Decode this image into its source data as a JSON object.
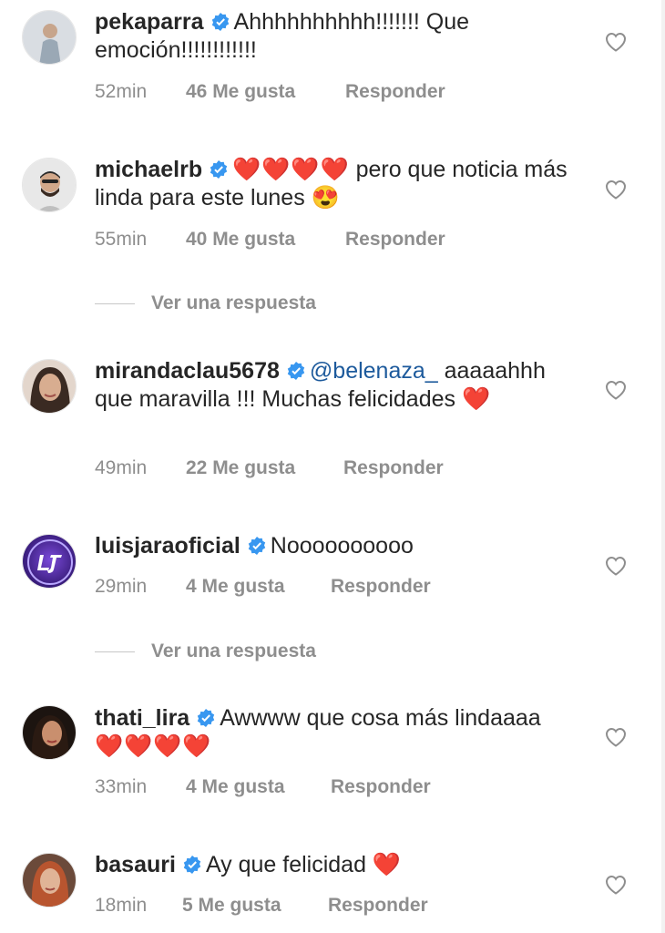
{
  "comments": [
    {
      "username": "pekaparra",
      "text": "Ahhhhhhhhhh!!!!!!! Que emoción!!!!!!!!!!!!",
      "time": "52min",
      "likes": "46 Me gusta",
      "reply": "Responder"
    },
    {
      "username": "michaelrb",
      "hearts": "❤️❤️❤️❤️",
      "text": " pero que noticia más linda para este lunes 😍",
      "time": "55min",
      "likes": "40 Me gusta",
      "reply": "Responder"
    },
    {
      "username": "mirandaclau5678",
      "mention": "@belenaza_",
      "text": " aaaaahhh que maravilla !!! Muchas felicidades ❤️",
      "time": "49min",
      "likes": "22 Me gusta",
      "reply": "Responder"
    },
    {
      "username": "luisjaraoficial",
      "text": "Noooooooooo",
      "time": "29min",
      "likes": "4 Me gusta",
      "reply": "Responder"
    },
    {
      "username": "thati_lira",
      "text": "Awwww que cosa más lindaaaa ",
      "hearts": "❤️❤️❤️❤️",
      "time": "33min",
      "likes": "4 Me gusta",
      "reply": "Responder"
    },
    {
      "username": "basauri",
      "text": "Ay que felicidad ❤️",
      "time": "18min",
      "likes": "5 Me gusta",
      "reply": "Responder"
    }
  ],
  "view_replies": [
    "Ver una respuesta",
    "Ver una respuesta"
  ],
  "icons": {
    "verified": "verified-badge-icon",
    "like": "heart-outline-icon"
  },
  "colors": {
    "verified": "#3897f0",
    "mention": "#1d5a9c",
    "meta": "#8e8e8e",
    "heart": "#e8112d"
  }
}
